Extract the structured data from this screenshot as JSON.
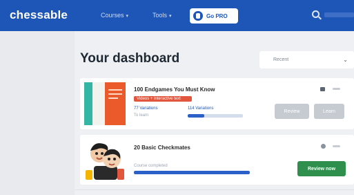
{
  "navbar": {
    "logo": "chessable",
    "menu": [
      "Courses",
      "Tools"
    ],
    "pro_button": "Go PRO",
    "search_placeholder": "Search"
  },
  "dashboard": {
    "title": "Your dashboard",
    "sort_selected": "Recent"
  },
  "courses": [
    {
      "title": "100 Endgames You Must Know",
      "tag": "Videos + interactive text",
      "meta_left_1": "77 Variations",
      "meta_left_2": "To learn",
      "meta_right": "114 Variations",
      "progress_fraction": 0.3,
      "button_1": "Review",
      "button_2": "Learn"
    },
    {
      "title": "20 Basic Checkmates",
      "meta": "Course completed",
      "progress_fraction": 1.0,
      "button": "Review now"
    }
  ],
  "colors": {
    "brand": "#1e56b8",
    "accent_green": "#2f8f4d",
    "tag_red": "#e2563d"
  }
}
